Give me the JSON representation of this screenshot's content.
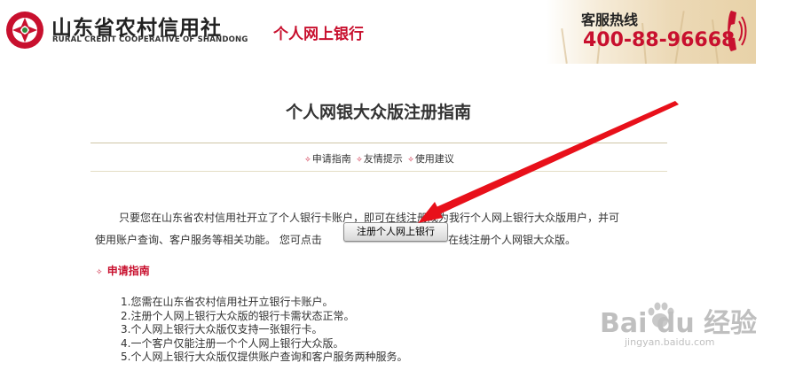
{
  "header": {
    "brand_cn": "山东省农村信用社",
    "brand_en": "RURAL CREDIT COOPERATIVE OF SHANDONG",
    "product": "个人网上银行",
    "hotline_label": "客服热线",
    "hotline_number": "400-88-96668"
  },
  "page": {
    "title": "个人网银大众版注册指南",
    "subnav": [
      "申请指南",
      "友情提示",
      "使用建议"
    ]
  },
  "intro": {
    "line1": "只要您在山东省农村信用社开立了个人银行卡账户，即可在线注册成为我行个人网上银行大众版用户，并可",
    "line2_before": "使用账户查询、客户服务等相关功能。 您可点击",
    "register_button": "注册个人网上银行",
    "line2_after": "在线注册个人网银大众版。"
  },
  "guide": {
    "heading": "申请指南",
    "items": [
      "1.您需在山东省农村信用社开立银行卡账户。",
      "2.注册个人网上银行大众版的银行卡需状态正常。",
      "3.个人网上银行大众版仅支持一张银行卡。",
      "4.一个客户仅能注册一个个人网上银行大众版。",
      "5.个人网上银行大众版仅提供账户查询和客户服务两种服务。"
    ]
  },
  "watermark": {
    "main": "Bai du 经验",
    "url": "jingyan.baidu.com"
  },
  "colors": {
    "brand_red": "#c8102e",
    "divider": "#cfc6a6",
    "arrow_red": "#e8101a"
  }
}
